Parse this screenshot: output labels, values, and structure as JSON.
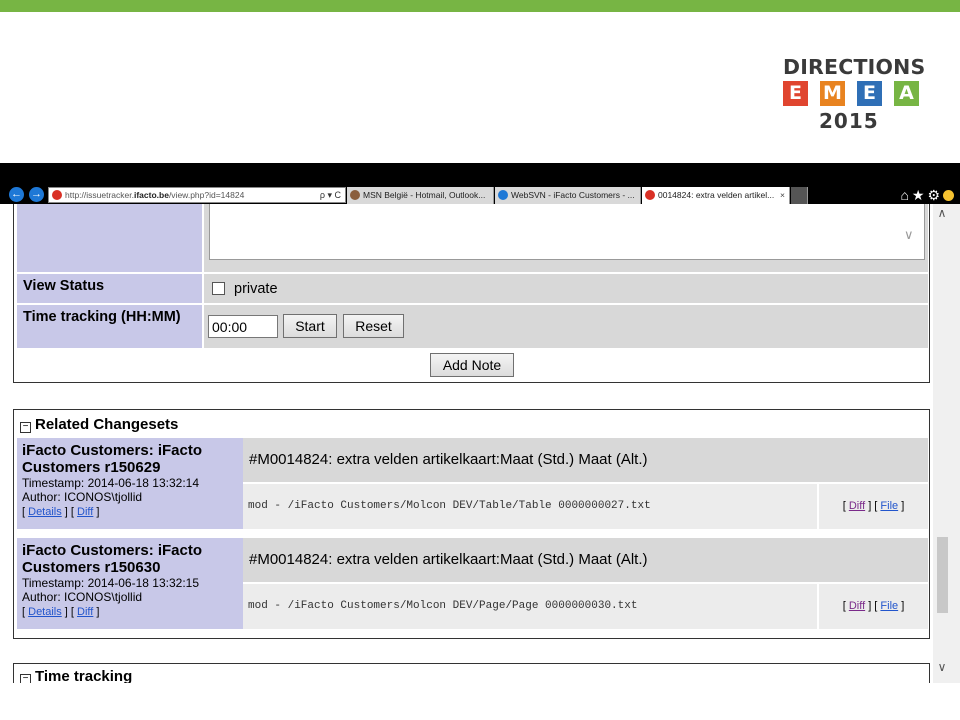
{
  "logo": {
    "word": "DIRECTIONS",
    "letters": [
      {
        "char": "E",
        "color": "#e0452f"
      },
      {
        "char": "M",
        "color": "#e88320"
      },
      {
        "char": "E",
        "color": "#2f6fb6"
      },
      {
        "char": "A",
        "color": "#77b544"
      }
    ],
    "year": "2015"
  },
  "browser": {
    "address_prefix": "http://issuetracker.",
    "address_host": "ifacto.be",
    "address_path": "/view.php?id=14824",
    "address_tools": "ρ ▾ C",
    "tabs": [
      {
        "label": "MSN België - Hotmail, Outlook...",
        "icon_color": "#8b5e3c"
      },
      {
        "label": "WebSVN - iFacto Customers - ...",
        "icon_color": "#1e78d6"
      },
      {
        "label": "0014824: extra velden artikel...",
        "icon_color": "#d93025",
        "close": "×"
      }
    ],
    "right_icons": "⌂★⚙"
  },
  "form": {
    "view_status_label": "View Status",
    "private_label": "private",
    "time_tracking_label": "Time tracking (HH:MM)",
    "time_value": "00:00",
    "start_label": "Start",
    "reset_label": "Reset",
    "add_note_label": "Add Note"
  },
  "related": {
    "title": "Related Changesets",
    "items": [
      {
        "title": "iFacto Customers: iFacto Customers r150629",
        "timestamp": "Timestamp: 2014-06-18 13:32:14",
        "author": "Author: ICONOS\\tjollid",
        "details": "Details",
        "diff": "Diff",
        "message": "#M0014824: extra velden artikelkaart:Maat (Std.) Maat (Alt.)",
        "file": "mod - /iFacto Customers/Molcon DEV/Table/Table 0000000027.txt",
        "file_diff": "Diff",
        "file_file": "File"
      },
      {
        "title": "iFacto Customers: iFacto Customers r150630",
        "timestamp": "Timestamp: 2014-06-18 13:32:15",
        "author": "Author: ICONOS\\tjollid",
        "details": "Details",
        "diff": "Diff",
        "message": "#M0014824: extra velden artikelkaart:Maat (Std.) Maat (Alt.)",
        "file": "mod - /iFacto Customers/Molcon DEV/Page/Page 0000000030.txt",
        "file_diff": "Diff",
        "file_file": "File"
      }
    ]
  },
  "time_tracking_section": {
    "title": "Time tracking"
  }
}
